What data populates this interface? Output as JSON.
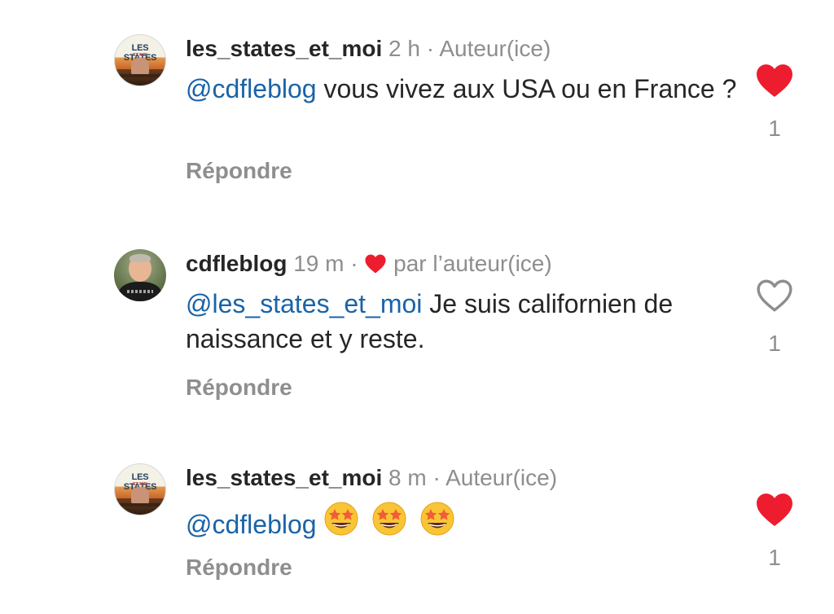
{
  "colors": {
    "liked_heart": "#ed1c2e",
    "mention": "#1a63a8",
    "meta_gray": "#8e8e8e",
    "text": "#262626"
  },
  "comments": [
    {
      "avatar": "les-states-avatar",
      "avatar_text": "LES STATES",
      "avatar_subtext": "ET MOI",
      "username": "les_states_et_moi",
      "time": "2 h",
      "separator": "·",
      "tag": "Auteur(ice)",
      "mention": "@cdfleblog",
      "text": "vous vivez aux USA ou en France ?",
      "reply_label": "Répondre",
      "liked": true,
      "like_count": "1"
    },
    {
      "avatar": "cdfleblog-avatar",
      "username": "cdfleblog",
      "time": "19 m",
      "separator": "·",
      "tag": "par l’auteur(ice)",
      "liked_by_author_icon": "heart-icon",
      "mention": "@les_states_et_moi",
      "text": "Je suis californien de naissance et y reste.",
      "reply_label": "Répondre",
      "liked": false,
      "like_count": "1"
    },
    {
      "avatar": "les-states-avatar",
      "avatar_text": "LES STATES",
      "avatar_subtext": "ET MOI",
      "username": "les_states_et_moi",
      "time": "8 m",
      "separator": "·",
      "tag": "Auteur(ice)",
      "mention": "@cdfleblog",
      "emojis": [
        "star-struck-emoji",
        "star-struck-emoji",
        "star-struck-emoji"
      ],
      "reply_label": "Répondre",
      "liked": true,
      "like_count": "1"
    }
  ]
}
